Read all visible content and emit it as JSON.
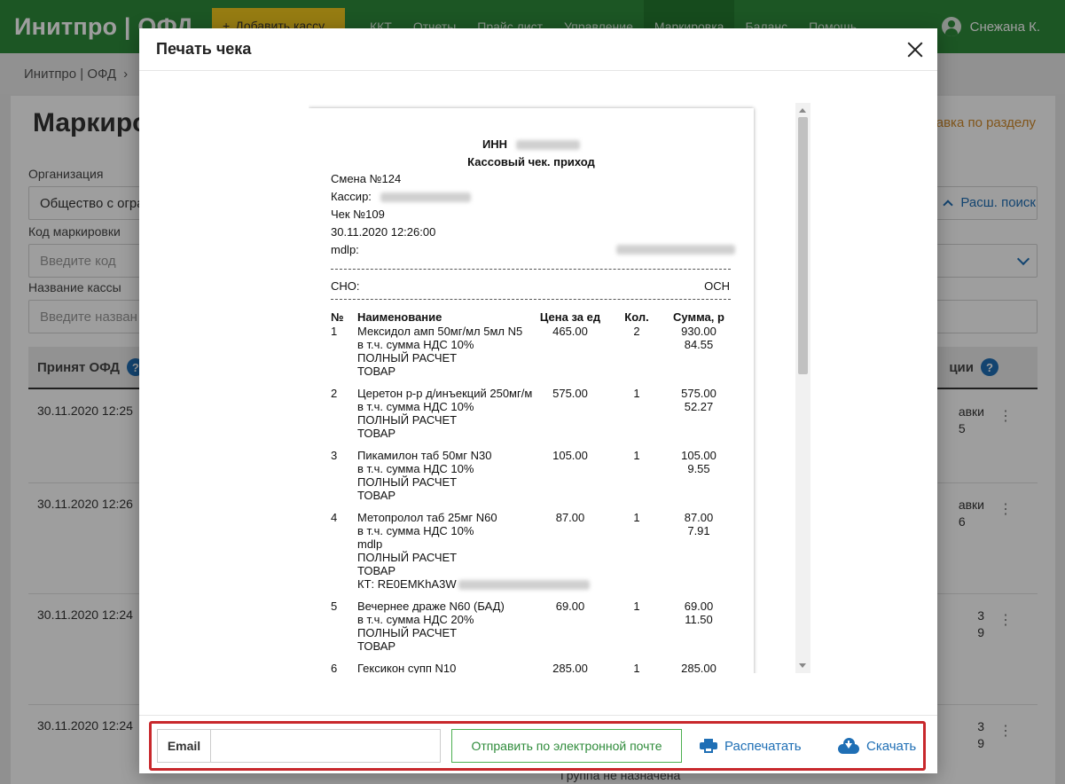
{
  "app": {
    "brand": "Инитпро | ОФД",
    "add_kassa": "Добавить кассу",
    "nav": [
      "ККТ",
      "Отчеты",
      "Прайс лист",
      "Управление",
      "Маркировка",
      "Баланс",
      "Помощь"
    ],
    "active_nav": "Маркировка",
    "user": "Снежана К.",
    "breadcrumb": [
      "Инитпро | ОФД",
      "›"
    ],
    "page_title": "Маркиро",
    "help_link": "авка по разделу",
    "advanced_search": "Расш. поиск",
    "filters": {
      "organization_label": "Организация",
      "organization_value": "Общество с огра",
      "marking_code_label": "Код маркировки",
      "marking_code_placeholder": "Введите код",
      "kassa_name_label": "Название кассы",
      "kassa_name_placeholder": "Введите назван"
    },
    "table": {
      "col_accepted": "Принят ОФД",
      "col_ops": "ции",
      "help_icon": "?",
      "rows": [
        {
          "date": "30.11.2020 12:25",
          "right1": "авки",
          "right2": "5"
        },
        {
          "date": "30.11.2020 12:26",
          "right1": "авки",
          "right2": "6"
        },
        {
          "date": "30.11.2020 12:24",
          "right1": "3",
          "right2": "9"
        },
        {
          "date": "30.11.2020 12:24",
          "right1": "3",
          "right2": "9"
        }
      ],
      "kebab": "⋮"
    },
    "bottom_text": "Группа не назначена"
  },
  "modal": {
    "title": "Печать чека",
    "receipt": {
      "inn_label": "ИНН",
      "doc_title": "Кассовый чек. приход",
      "shift": "Смена №124",
      "cashier_label": "Кассир:",
      "check_no": "Чек №109",
      "datetime": "30.11.2020 12:26:00",
      "mdlp_label": "mdlp:",
      "sno_label": "СНО:",
      "sno_value": "ОСН",
      "headers": {
        "no": "№",
        "name": "Наименование",
        "price": "Цена за ед",
        "qty": "Кол.",
        "sum": "Сумма, р"
      },
      "items": [
        {
          "no": "1",
          "lines": [
            "Мексидол амп 50мг/мл 5мл N5",
            "в т.ч. сумма НДС 10%",
            "ПОЛНЫЙ РАСЧЕТ",
            "ТОВАР"
          ],
          "price": "465.00",
          "qty": "2",
          "sum": "930.00",
          "vat": "84.55"
        },
        {
          "no": "2",
          "lines": [
            "Церетон р-р д/инъекций 250мг/м",
            "в т.ч. сумма НДС 10%",
            "ПОЛНЫЙ РАСЧЕТ",
            "ТОВАР"
          ],
          "price": "575.00",
          "qty": "1",
          "sum": "575.00",
          "vat": "52.27"
        },
        {
          "no": "3",
          "lines": [
            "Пикамилон таб 50мг N30",
            "в т.ч. сумма НДС 10%",
            "ПОЛНЫЙ РАСЧЕТ",
            "ТОВАР"
          ],
          "price": "105.00",
          "qty": "1",
          "sum": "105.00",
          "vat": "9.55"
        },
        {
          "no": "4",
          "lines": [
            "Метопролол таб 25мг N60",
            "в т.ч. сумма НДС 10%",
            "mdlp",
            "ПОЛНЫЙ РАСЧЕТ",
            "ТОВАР",
            "КТ: RE0EMKhA3W"
          ],
          "price": "87.00",
          "qty": "1",
          "sum": "87.00",
          "vat": "7.91"
        },
        {
          "no": "5",
          "lines": [
            "Вечернее драже N60 (БАД)",
            "в т.ч. сумма НДС 20%",
            "ПОЛНЫЙ РАСЧЕТ",
            "ТОВАР"
          ],
          "price": "69.00",
          "qty": "1",
          "sum": "69.00",
          "vat": "11.50"
        },
        {
          "no": "6",
          "lines": [
            "Гексикон супп N10"
          ],
          "price": "285.00",
          "qty": "1",
          "sum": "285.00",
          "vat": ""
        }
      ]
    },
    "footer": {
      "email_label": "Email",
      "email_value": "",
      "send_button": "Отправить по электронной почте",
      "print_button": "Распечатать",
      "download_button": "Скачать"
    }
  },
  "colors": {
    "header_green": "#2e8b3a",
    "accent_yellow": "#f3c81e",
    "link_blue": "#1f6fb5",
    "highlight_red": "#c8282c"
  }
}
